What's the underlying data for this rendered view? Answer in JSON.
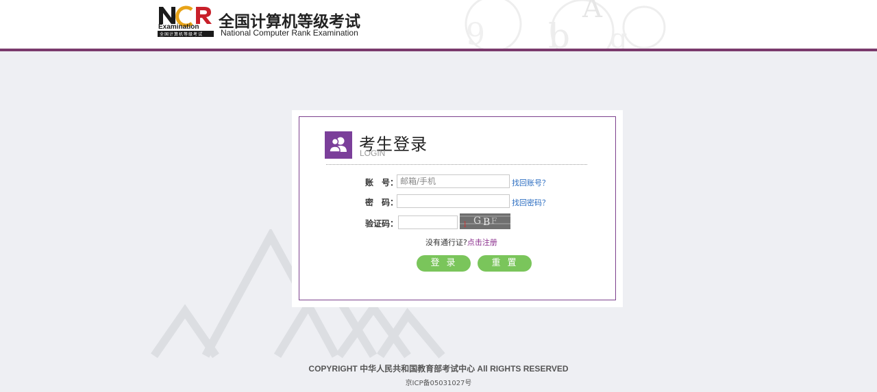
{
  "header": {
    "logo_cn": "全国计算机等级考试",
    "logo_en": "National Computer Rank Examination",
    "logo_mark_word": "Examination",
    "logo_mark_small": "全国计算机等级考试"
  },
  "login": {
    "title": "考生登录",
    "subtitle": "LOGIN",
    "account_label": "账　号：",
    "account_placeholder": "邮箱/手机",
    "account_value": "",
    "find_account_link": "找回账号？",
    "password_label": "密　码：",
    "password_value": "",
    "find_password_link": "找回密码？",
    "captcha_label": "验证码：",
    "captcha_value": "",
    "no_pass_text": "没有通行证?",
    "register_link": "点击注册",
    "login_button": "登录",
    "reset_button": "重置"
  },
  "footer": {
    "copyright": "COPYRIGHT 中华人民共和国教育部考试中心 All RIGHTS RESERVED",
    "icp": "京ICP备05031027号"
  },
  "colors": {
    "brand_purple": "#7b3f9a",
    "header_bar": "#7a3a6c",
    "button_green": "#7ac55b",
    "link_blue": "#2b6dc1",
    "page_bg": "#eeeff3"
  }
}
